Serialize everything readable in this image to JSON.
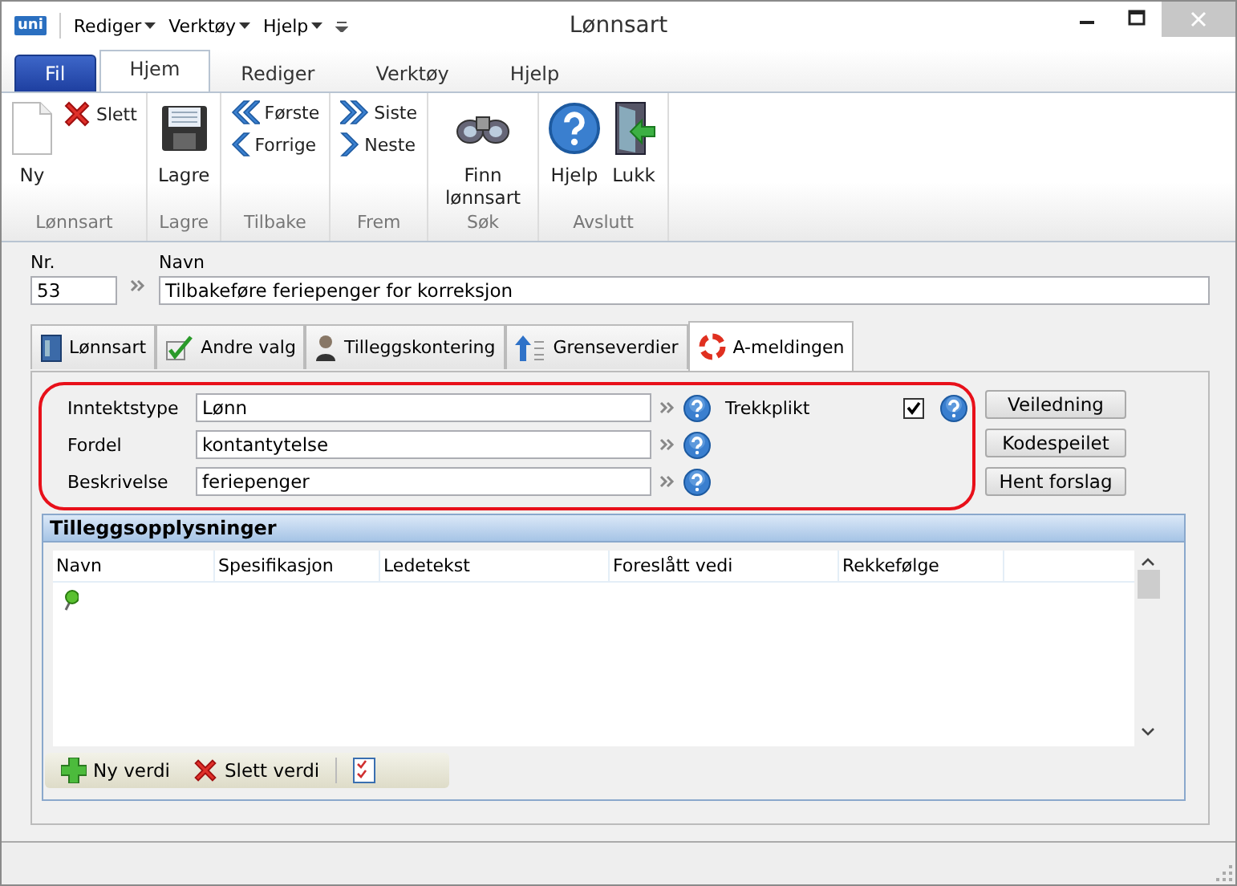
{
  "window": {
    "title": "Lønnsart",
    "logo": "uni"
  },
  "quick_menu": [
    {
      "label": "Rediger"
    },
    {
      "label": "Verktøy"
    },
    {
      "label": "Hjelp"
    }
  ],
  "ribbon": {
    "tabs": [
      {
        "label": "Fil",
        "kind": "file",
        "selected": false
      },
      {
        "label": "Hjem",
        "kind": "tab",
        "selected": true
      },
      {
        "label": "Rediger",
        "kind": "tab",
        "selected": false
      },
      {
        "label": "Verktøy",
        "kind": "tab",
        "selected": false
      },
      {
        "label": "Hjelp",
        "kind": "tab",
        "selected": false
      }
    ],
    "groups": [
      {
        "label": "Lønnsart",
        "buttons": [
          {
            "label": "Ny",
            "kind": "large"
          },
          {
            "label": "Slett",
            "kind": "small"
          }
        ]
      },
      {
        "label": "Lagre",
        "buttons": [
          {
            "label": "Lagre",
            "kind": "large"
          }
        ]
      },
      {
        "label": "Tilbake",
        "buttons": [
          {
            "label": "Første",
            "kind": "small"
          },
          {
            "label": "Forrige",
            "kind": "small"
          }
        ]
      },
      {
        "label": "Frem",
        "buttons": [
          {
            "label": "Siste",
            "kind": "small"
          },
          {
            "label": "Neste",
            "kind": "small"
          }
        ]
      },
      {
        "label": "Søk",
        "buttons": [
          {
            "label": "Finn lønnsart",
            "kind": "large"
          }
        ]
      },
      {
        "label": "Avslutt",
        "buttons": [
          {
            "label": "Hjelp",
            "kind": "large"
          },
          {
            "label": "Lukk",
            "kind": "large"
          }
        ]
      }
    ]
  },
  "number": {
    "label": "Nr.",
    "value": "53"
  },
  "name": {
    "label": "Navn",
    "value": "Tilbakeføre feriepenger for korreksjon"
  },
  "tabs": [
    {
      "label": "Lønnsart",
      "selected": false
    },
    {
      "label": "Andre valg",
      "selected": false
    },
    {
      "label": "Tilleggskontering",
      "selected": false
    },
    {
      "label": "Grenseverdier",
      "selected": false
    },
    {
      "label": "A-meldingen",
      "selected": true
    }
  ],
  "a_melding": {
    "fields": [
      {
        "label": "Inntektstype",
        "value": "Lønn"
      },
      {
        "label": "Fordel",
        "value": "kontantytelse"
      },
      {
        "label": "Beskrivelse",
        "value": "feriepenger"
      }
    ],
    "trekkplikt": {
      "label": "Trekkplikt",
      "checked": true
    },
    "buttons": [
      {
        "label": "Veiledning"
      },
      {
        "label": "Kodespeilet"
      },
      {
        "label": "Hent forslag"
      }
    ]
  },
  "grid": {
    "title": "Tilleggsopplysninger",
    "columns": [
      "Navn",
      "Spesifikasjon",
      "Ledetekst",
      "Foreslått vedi",
      "Rekkefølge"
    ],
    "toolbar": [
      {
        "label": "Ny verdi",
        "kind": "add"
      },
      {
        "label": "Slett verdi",
        "kind": "delete"
      },
      {
        "kind": "checklist"
      }
    ]
  }
}
